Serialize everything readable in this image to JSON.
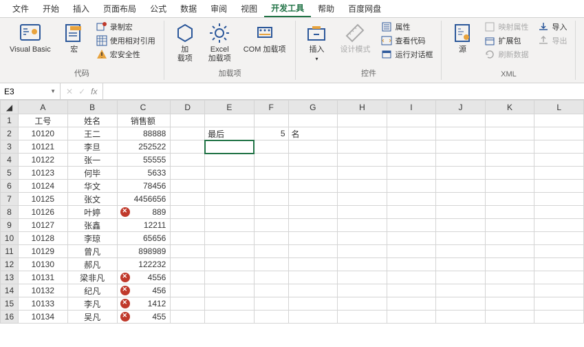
{
  "tabs": [
    "文件",
    "开始",
    "插入",
    "页面布局",
    "公式",
    "数据",
    "审阅",
    "视图",
    "开发工具",
    "帮助",
    "百度网盘"
  ],
  "active_tab": 8,
  "ribbon": {
    "group_code": {
      "label": "代码",
      "vb": "Visual Basic",
      "macro": "宏",
      "record": "录制宏",
      "relref": "使用相对引用",
      "security": "宏安全性"
    },
    "group_addins": {
      "label": "加载项",
      "addins": "加\n载项",
      "excel_addins": "Excel\n加载项",
      "com_addins": "COM 加载项"
    },
    "group_controls": {
      "label": "控件",
      "insert": "插入",
      "design": "设计模式",
      "properties": "属性",
      "viewcode": "查看代码",
      "rundlg": "运行对话框"
    },
    "group_xml": {
      "label": "XML",
      "source": "源",
      "mapprops": "映射属性",
      "expand": "扩展包",
      "refresh": "刷新数据",
      "import": "导入",
      "export": "导出"
    }
  },
  "namebox": "E3",
  "formula": "",
  "columns": [
    "A",
    "B",
    "C",
    "D",
    "E",
    "F",
    "G",
    "H",
    "I",
    "J",
    "K",
    "L"
  ],
  "header_row": {
    "A": "工号",
    "B": "姓名",
    "C": "销售额"
  },
  "e2": "最后",
  "f2": "5",
  "g2": "名",
  "rows": [
    {
      "r": 2,
      "A": "10120",
      "B": "王二",
      "C": "88888"
    },
    {
      "r": 3,
      "A": "10121",
      "B": "李旦",
      "C": "252522"
    },
    {
      "r": 4,
      "A": "10122",
      "B": "张一",
      "C": "55555"
    },
    {
      "r": 5,
      "A": "10123",
      "B": "何毕",
      "C": "5633"
    },
    {
      "r": 6,
      "A": "10124",
      "B": "华文",
      "C": "78456"
    },
    {
      "r": 7,
      "A": "10125",
      "B": "张文",
      "C": "4456656"
    },
    {
      "r": 8,
      "A": "10126",
      "B": "叶婷",
      "C": "889",
      "icon": true
    },
    {
      "r": 9,
      "A": "10127",
      "B": "张鑫",
      "C": "12211"
    },
    {
      "r": 10,
      "A": "10128",
      "B": "李琼",
      "C": "65656"
    },
    {
      "r": 11,
      "A": "10129",
      "B": "曾凡",
      "C": "898989"
    },
    {
      "r": 12,
      "A": "10130",
      "B": "郝凡",
      "C": "122232"
    },
    {
      "r": 13,
      "A": "10131",
      "B": "梁非凡",
      "C": "4556",
      "icon": true
    },
    {
      "r": 14,
      "A": "10132",
      "B": "纪凡",
      "C": "456",
      "icon": true
    },
    {
      "r": 15,
      "A": "10133",
      "B": "李凡",
      "C": "1412",
      "icon": true
    },
    {
      "r": 16,
      "A": "10134",
      "B": "吴凡",
      "C": "455",
      "icon": true
    }
  ],
  "chart_data": {
    "type": "table",
    "columns": [
      "工号",
      "姓名",
      "销售额"
    ],
    "data": [
      [
        "10120",
        "王二",
        88888
      ],
      [
        "10121",
        "李旦",
        252522
      ],
      [
        "10122",
        "张一",
        55555
      ],
      [
        "10123",
        "何毕",
        5633
      ],
      [
        "10124",
        "华文",
        78456
      ],
      [
        "10125",
        "张文",
        4456656
      ],
      [
        "10126",
        "叶婷",
        889
      ],
      [
        "10127",
        "张鑫",
        12211
      ],
      [
        "10128",
        "李琼",
        65656
      ],
      [
        "10129",
        "曾凡",
        898989
      ],
      [
        "10130",
        "郝凡",
        122232
      ],
      [
        "10131",
        "梁非凡",
        4556
      ],
      [
        "10132",
        "纪凡",
        456
      ],
      [
        "10133",
        "李凡",
        1412
      ],
      [
        "10134",
        "吴凡",
        455
      ]
    ]
  }
}
